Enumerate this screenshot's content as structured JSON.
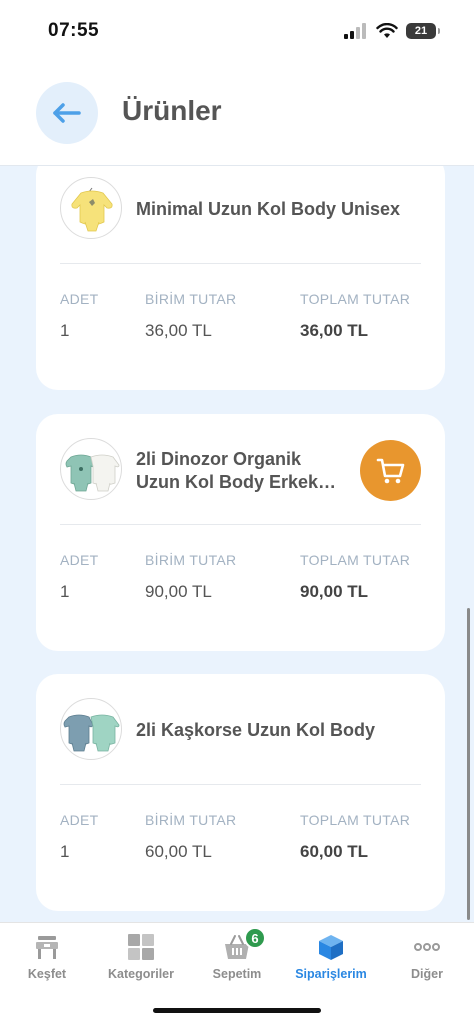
{
  "status": {
    "time": "07:55",
    "battery": "21"
  },
  "header": {
    "title": "Ürünler",
    "back_icon": "arrow-left-icon"
  },
  "columns": {
    "qty": "ADET",
    "unit_price": "BİRİM TUTAR",
    "total": "TOPLAM TUTAR"
  },
  "products": [
    {
      "name_line1": "Minimal Uzun Kol Body Unisex",
      "name_line2": "",
      "qty": "1",
      "unit_price": "36,00 TL",
      "total": "36,00 TL",
      "has_cart": false
    },
    {
      "name_line1": "2li Dinozor Organik",
      "name_line2": "Uzun Kol Body Erkek…",
      "qty": "1",
      "unit_price": "90,00 TL",
      "total": "90,00 TL",
      "has_cart": true
    },
    {
      "name_line1": "2li Kaşkorse Uzun Kol Body",
      "name_line2": "",
      "qty": "1",
      "unit_price": "60,00 TL",
      "total": "60,00 TL",
      "has_cart": false
    }
  ],
  "tabs": [
    {
      "label": "Keşfet",
      "icon": "discover-icon",
      "active": false
    },
    {
      "label": "Kategoriler",
      "icon": "grid-icon",
      "active": false
    },
    {
      "label": "Sepetim",
      "icon": "basket-icon",
      "active": false,
      "badge": "6"
    },
    {
      "label": "Siparişlerim",
      "icon": "box-icon",
      "active": true
    },
    {
      "label": "Diğer",
      "icon": "more-icon",
      "active": false
    }
  ],
  "colors": {
    "accent": "#2a87e2",
    "cart": "#e8962e",
    "badge": "#2f9a4e",
    "background": "#eaf3fd"
  }
}
